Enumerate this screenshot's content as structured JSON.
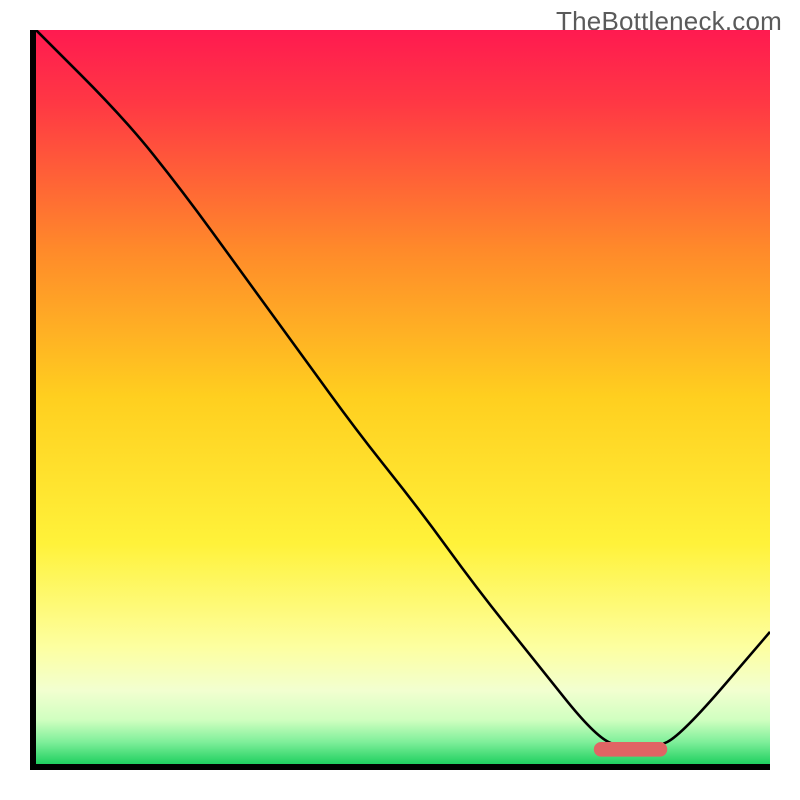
{
  "watermark": "TheBottleneck.com",
  "chart_data": {
    "type": "line",
    "title": "",
    "xlabel": "",
    "ylabel": "",
    "xlim": [
      0,
      100
    ],
    "ylim": [
      0,
      100
    ],
    "x": [
      0,
      12,
      20,
      28,
      36,
      44,
      52,
      60,
      68,
      76,
      80,
      84,
      88,
      100
    ],
    "values": [
      100,
      88,
      78,
      67,
      56,
      45,
      35,
      24,
      14,
      4,
      2,
      2,
      4,
      18
    ],
    "marker": {
      "x_start": 76,
      "x_end": 86,
      "y": 2,
      "color": "#e06464"
    },
    "gradient_stops": [
      {
        "offset": 0.0,
        "color": "#ff1a50"
      },
      {
        "offset": 0.1,
        "color": "#ff3844"
      },
      {
        "offset": 0.3,
        "color": "#ff8a2a"
      },
      {
        "offset": 0.5,
        "color": "#ffcf1f"
      },
      {
        "offset": 0.7,
        "color": "#fff23a"
      },
      {
        "offset": 0.84,
        "color": "#fdffa0"
      },
      {
        "offset": 0.9,
        "color": "#f2ffd0"
      },
      {
        "offset": 0.94,
        "color": "#d0ffc0"
      },
      {
        "offset": 0.97,
        "color": "#7fef9a"
      },
      {
        "offset": 1.0,
        "color": "#20d060"
      }
    ]
  }
}
